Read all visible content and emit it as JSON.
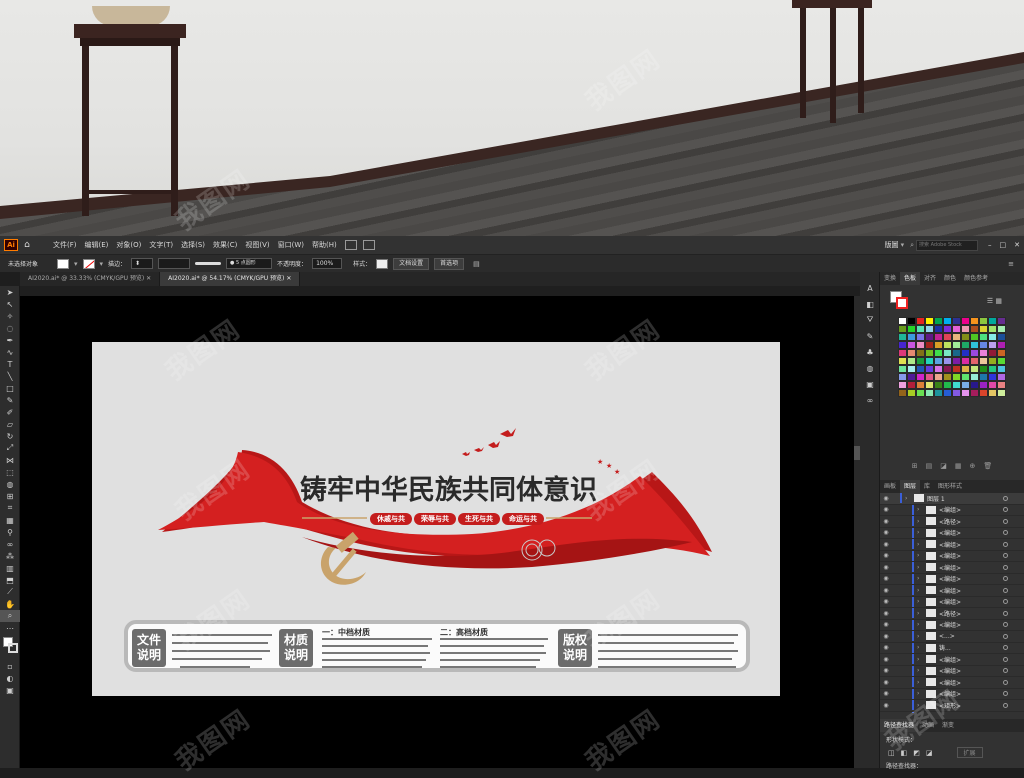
{
  "menubar": {
    "app_icon": "Ai",
    "items": [
      "文件(F)",
      "编辑(E)",
      "对象(O)",
      "文字(T)",
      "选择(S)",
      "效果(C)",
      "视图(V)",
      "窗口(W)",
      "帮助(H)"
    ],
    "workspace": "版圖",
    "search_placeholder": "搜索 Adobe Stock"
  },
  "controlbar": {
    "selection": "未选择对象",
    "stroke_label": "描边：",
    "brush": "5 点圆形",
    "opacity_label": "不透明度：",
    "opacity_value": "100%",
    "style_label": "样式：",
    "doc_setup": "文档设置",
    "prefs": "首选项"
  },
  "tabs": [
    {
      "label": "AI2020.ai* @ 33.33% (CMYK/GPU 预览)",
      "active": false
    },
    {
      "label": "AI2020.ai* @ 54.17% (CMYK/GPU 预览)",
      "active": true
    }
  ],
  "artwork": {
    "title": "铸牢中华民族共同体意识",
    "pills": [
      "休戚与共",
      "荣辱与共",
      "生死与共",
      "命运与共"
    ],
    "info": {
      "file_tag": [
        "文件",
        "说明"
      ],
      "material_tag": [
        "材质",
        "说明"
      ],
      "copyright_tag": [
        "版权",
        "说明"
      ],
      "mid_material": "一：中档材质",
      "high_material": "二：高档材质"
    }
  },
  "panels": {
    "color_tabs": [
      "变换",
      "色板",
      "对齐",
      "颜色",
      "颜色参考"
    ],
    "layer_tabs": [
      "画板",
      "图层",
      "库",
      "图形样式"
    ],
    "layers": [
      {
        "name": "图层 1",
        "kind": "layer"
      },
      {
        "name": "<编组>"
      },
      {
        "name": "<路径>"
      },
      {
        "name": "<编组>"
      },
      {
        "name": "<编组>"
      },
      {
        "name": "<编组>"
      },
      {
        "name": "<编组>"
      },
      {
        "name": "<编组>"
      },
      {
        "name": "<编组>"
      },
      {
        "name": "<编组>"
      },
      {
        "name": "<路径>"
      },
      {
        "name": "<编组>"
      },
      {
        "name": "<...>"
      },
      {
        "name": "铸..."
      },
      {
        "name": "<编组>"
      },
      {
        "name": "<编组>"
      },
      {
        "name": "<编组>"
      },
      {
        "name": "<编组>"
      },
      {
        "name": "<矩形>"
      },
      {
        "name": "<编组>"
      }
    ],
    "pathfinder_tabs": [
      "路径查找器",
      "动画",
      "渐变"
    ],
    "shape_modes_label": "形状模式：",
    "expand_label": "扩展",
    "pathfinder_label": "路径查找器："
  },
  "watermark": "我图网",
  "colors": {
    "accent_red": "#c41d1d",
    "ribbon_red": "#d42020",
    "gold": "#c9a36b",
    "chrome": "#323232"
  }
}
